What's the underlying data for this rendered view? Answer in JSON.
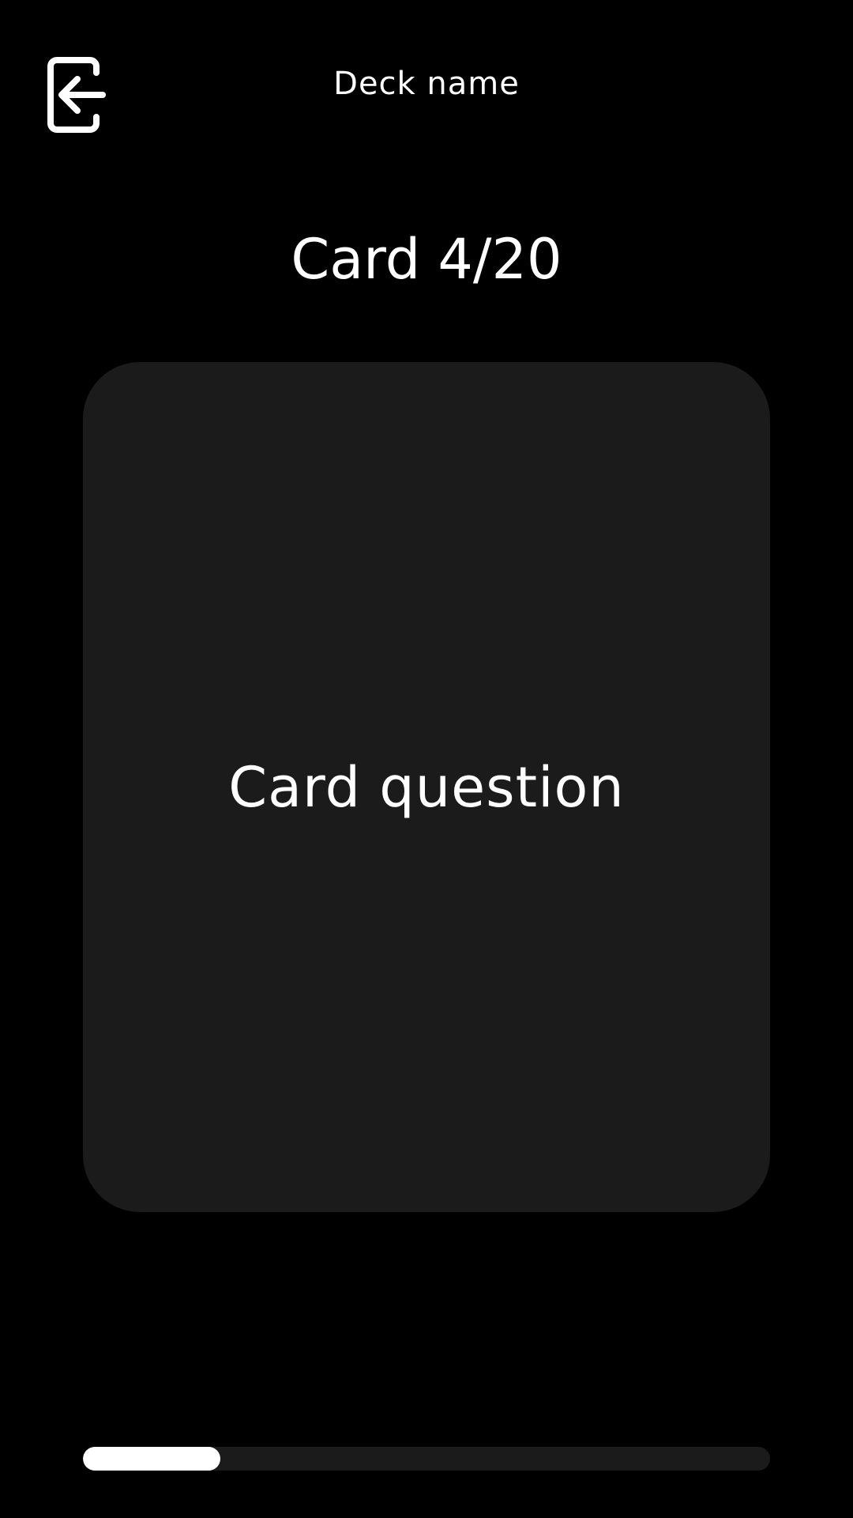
{
  "header": {
    "exit_icon": "exit-arrow-left-icon",
    "deck_name": "Deck name"
  },
  "counter": {
    "label": "Card 4/20"
  },
  "card": {
    "question": "Card question"
  },
  "progress": {
    "current": 4,
    "total": 20,
    "fraction": 0.2
  },
  "colors": {
    "background": "#000000",
    "card_background": "#1b1b1b",
    "text": "#ffffff",
    "progress_track": "#1b1b1b",
    "progress_fill": "#ffffff"
  }
}
